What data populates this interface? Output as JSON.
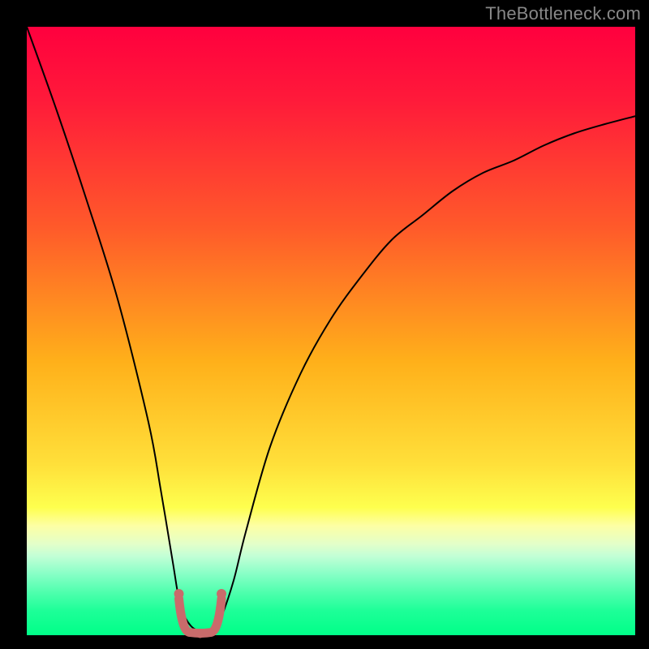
{
  "watermark": "TheBottleneck.com",
  "chart_data": {
    "type": "line",
    "title": "",
    "xlabel": "",
    "ylabel": "",
    "xlim": [
      0,
      100
    ],
    "ylim": [
      0,
      100
    ],
    "x": [
      0,
      5,
      10,
      15,
      20,
      22,
      24,
      25,
      26,
      27,
      28,
      29,
      30,
      31,
      32,
      34,
      36,
      40,
      45,
      50,
      55,
      60,
      65,
      70,
      75,
      80,
      85,
      90,
      95,
      100
    ],
    "values": [
      100,
      86,
      71,
      55,
      35,
      24,
      12,
      6,
      3,
      1.5,
      0.8,
      0.6,
      0.7,
      1.2,
      3,
      9,
      17,
      31,
      43,
      52,
      59,
      65,
      69,
      73,
      76,
      78,
      80.5,
      82.5,
      84,
      85.3
    ],
    "valley_region": {
      "x_start": 25,
      "x_end": 32,
      "y_floor": 0.6
    },
    "gradient_stops": [
      {
        "pos": 0.0,
        "color": "#ff003e"
      },
      {
        "pos": 0.33,
        "color": "#ff5a2a"
      },
      {
        "pos": 0.72,
        "color": "#ffe03a"
      },
      {
        "pos": 0.88,
        "color": "#c2ffd6"
      },
      {
        "pos": 1.0,
        "color": "#00ff88"
      }
    ]
  }
}
